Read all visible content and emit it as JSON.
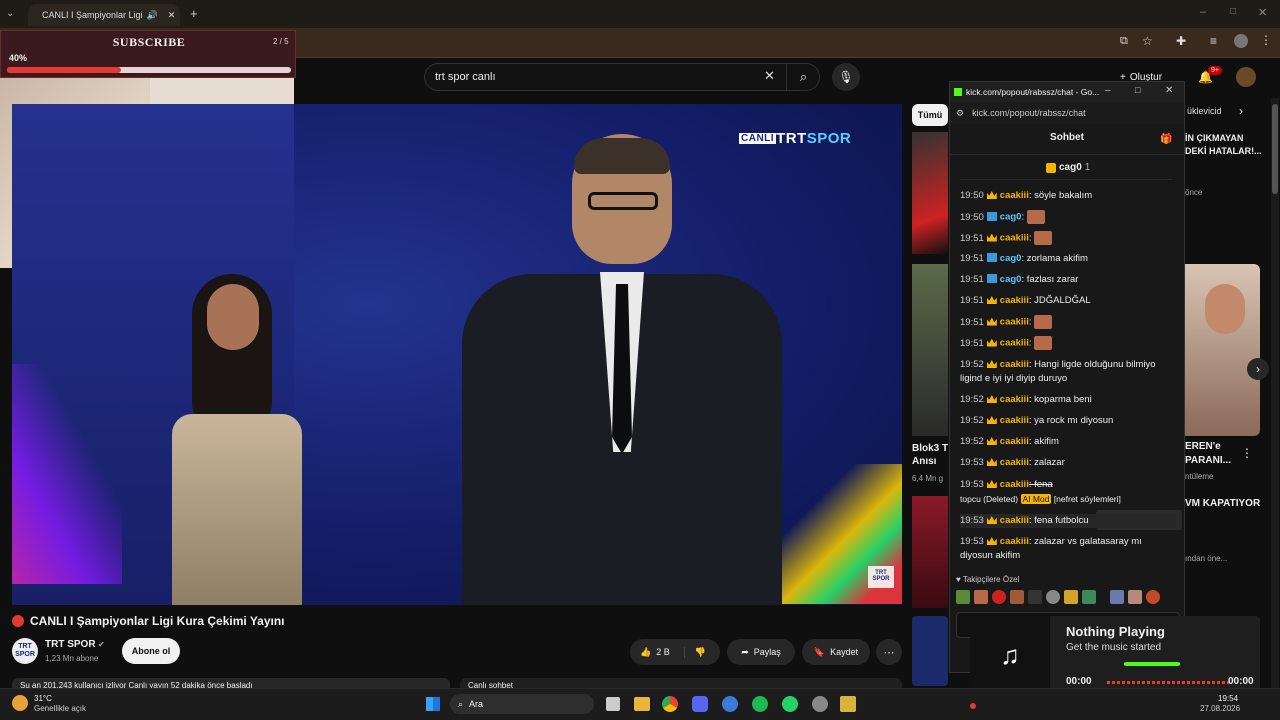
{
  "browser": {
    "tab_title": "CANLI I Şampiyonlar Ligi",
    "new_tab_icon": "plus-icon"
  },
  "overlay": {
    "subscribe_label": "SUBSCRIBE",
    "progress_text": "40%",
    "progress_value": 0.4,
    "counter": "2 / 5"
  },
  "youtube": {
    "search_value": "trt spor canlı",
    "create_label": "Oluştur",
    "notif_badge": "9+",
    "filter_all": "Tümü",
    "filter_uploaded": "üklevicid",
    "video_title": "CANLI I Şampiyonlar Ligi Kura Çekimi Yayını",
    "channel_name": "TRT SPOR",
    "subscribers": "1,23 Mn abone",
    "subscribe_button": "Abone ol",
    "likes": "2 B",
    "share": "Paylaş",
    "save": "Kaydet",
    "live_bar_left": "Şu an 201.243 kullanıcı izliyor  Canlı yayın 52 dakika önce başladı",
    "live_chat_label": "Canlı sohbet",
    "logo_text": "CANLI TRTSPOR",
    "rec1_title": "Blok3 T\nAnısı",
    "rec1_meta": "6,4 Mn g",
    "rec2_title": "EREN'e\nPARANI...",
    "rec2_meta": "ntüleme",
    "rec3_title": "VM KAPATIYOR",
    "rec3_meta": "ından öne...",
    "rec_top_title": "İN ÇIKMAYAN\nDEKİ HATALAR!...",
    "rec_top_meta": "önce"
  },
  "chat": {
    "window_title": "kick.com/popout/rabssz/chat - Go...",
    "url": "kick.com/popout/rabssz/chat",
    "header": "Sohbet",
    "pinned_user": "cag0",
    "pinned_count": "1",
    "messages": [
      {
        "time": "19:50",
        "user": "caakiii",
        "text": ": söyle bakalım",
        "badge": "crown"
      },
      {
        "time": "19:50",
        "user": "cag0",
        "text": ":",
        "badge": "arrow",
        "emote": true
      },
      {
        "time": "19:51",
        "user": "caakiii",
        "text": ":",
        "badge": "crown",
        "emote": true
      },
      {
        "time": "19:51",
        "user": "cag0",
        "text": ": zorlama akifim",
        "badge": "arrow"
      },
      {
        "time": "19:51",
        "user": "cag0",
        "text": ": fazlası zarar",
        "badge": "arrow"
      },
      {
        "time": "19:51",
        "user": "caakiii",
        "text": ": JDĞALDĞAL",
        "badge": "crown"
      },
      {
        "time": "19:51",
        "user": "caakiii",
        "text": ":",
        "badge": "crown",
        "emote": true
      },
      {
        "time": "19:51",
        "user": "caakiii",
        "text": ":",
        "badge": "crown",
        "emote": true
      },
      {
        "time": "19:52",
        "user": "caakiii",
        "text": ": Hangi ligde olduğunu bilmiyo ligind e iyi iyi diyip duruyo",
        "badge": "crown"
      },
      {
        "time": "19:52",
        "user": "caakiii",
        "text": ": koparma beni",
        "badge": "crown"
      },
      {
        "time": "19:52",
        "user": "caakiii",
        "text": ": ya rock mı diyosun",
        "badge": "crown"
      },
      {
        "time": "19:52",
        "user": "caakiii",
        "text": ": akifim",
        "badge": "crown"
      },
      {
        "time": "19:53",
        "user": "caakiii",
        "text": ": zalazar",
        "badge": "crown"
      },
      {
        "time": "19:53",
        "user": "caakiii",
        "text": ": fena",
        "badge": "crown"
      },
      {
        "time": "19:53",
        "user": "caakiii",
        "text": ": fena futbolcu",
        "badge": "crown"
      },
      {
        "time": "19:53",
        "user": "caakiii",
        "text": ": zalazar vs galatasaray mı diyosun akifim",
        "badge": "crown"
      }
    ],
    "deleted_line": "topcu (Deleted)",
    "ai_mod": "AI Mod",
    "ai_reason": "[nefret söylemleri]",
    "followers_label": "Takipçilere Özel"
  },
  "music": {
    "title": "Nothing Playing",
    "subtitle": "Get the music started",
    "time_left": "00:00",
    "time_right": "00:00"
  },
  "taskbar": {
    "weather_temp": "31°C",
    "weather_desc": "Genellikle açık",
    "search_label": "Ara",
    "clock_time": "19:54",
    "clock_date": "27.08.2026"
  },
  "colors": {
    "accent_red": "#e53935",
    "kick_green": "#53fc18",
    "crown_gold": "#f7b500"
  }
}
